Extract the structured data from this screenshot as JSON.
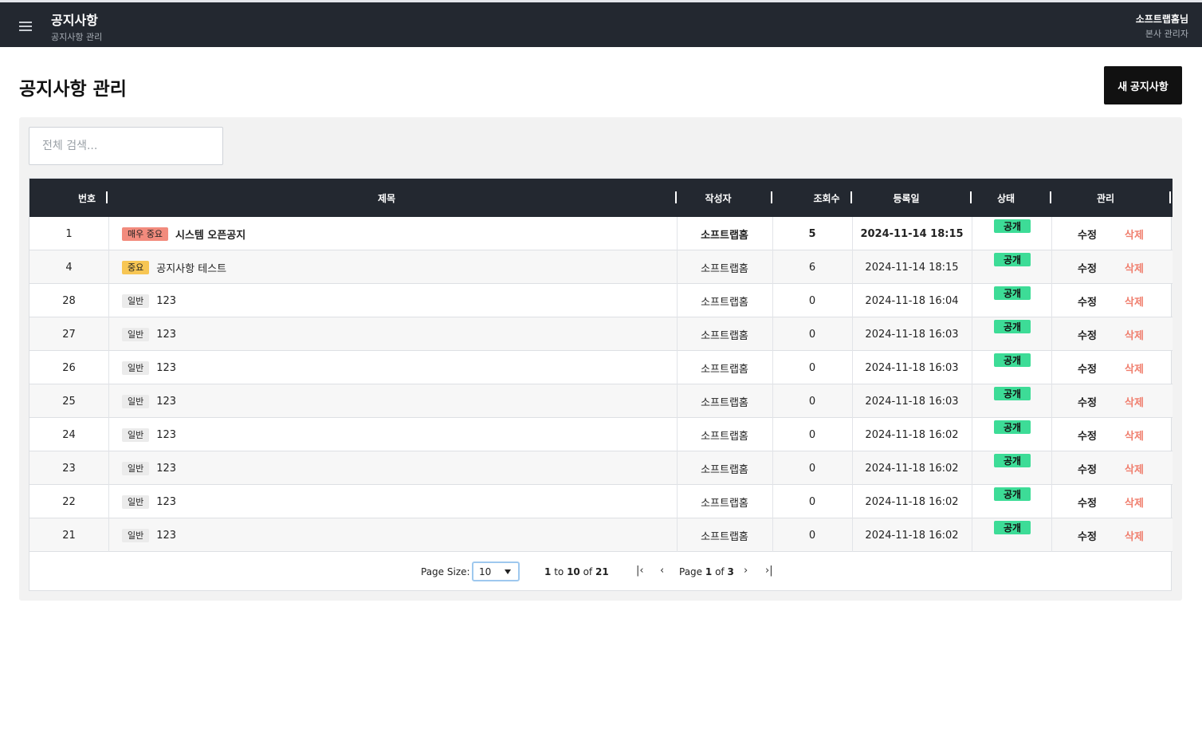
{
  "header": {
    "title": "공지사항",
    "subtitle": "공지사항 관리",
    "user_name": "소프트랩홈님",
    "user_role": "본사 관리자"
  },
  "page": {
    "title": "공지사항 관리",
    "new_button": "새 공지사항",
    "search_placeholder": "전체 검색..."
  },
  "table": {
    "columns": [
      "번호",
      "제목",
      "작성자",
      "조회수",
      "등록일",
      "상태",
      "관리"
    ],
    "edit_label": "수정",
    "delete_label": "삭제",
    "rows": [
      {
        "no": "1",
        "badge": "매우 중요",
        "badge_type": "urgent",
        "title": "시스템 오픈공지",
        "author": "소프트랩홈",
        "views": "5",
        "date": "2024-11-14 18:15",
        "status": "공개",
        "bold": true
      },
      {
        "no": "4",
        "badge": "중요",
        "badge_type": "important",
        "title": "공지사항 테스트",
        "author": "소프트랩홈",
        "views": "6",
        "date": "2024-11-14 18:15",
        "status": "공개",
        "bold": false
      },
      {
        "no": "28",
        "badge": "일반",
        "badge_type": "normal",
        "title": "123",
        "author": "소프트랩홈",
        "views": "0",
        "date": "2024-11-18 16:04",
        "status": "공개",
        "bold": false
      },
      {
        "no": "27",
        "badge": "일반",
        "badge_type": "normal",
        "title": "123",
        "author": "소프트랩홈",
        "views": "0",
        "date": "2024-11-18 16:03",
        "status": "공개",
        "bold": false
      },
      {
        "no": "26",
        "badge": "일반",
        "badge_type": "normal",
        "title": "123",
        "author": "소프트랩홈",
        "views": "0",
        "date": "2024-11-18 16:03",
        "status": "공개",
        "bold": false
      },
      {
        "no": "25",
        "badge": "일반",
        "badge_type": "normal",
        "title": "123",
        "author": "소프트랩홈",
        "views": "0",
        "date": "2024-11-18 16:03",
        "status": "공개",
        "bold": false
      },
      {
        "no": "24",
        "badge": "일반",
        "badge_type": "normal",
        "title": "123",
        "author": "소프트랩홈",
        "views": "0",
        "date": "2024-11-18 16:02",
        "status": "공개",
        "bold": false
      },
      {
        "no": "23",
        "badge": "일반",
        "badge_type": "normal",
        "title": "123",
        "author": "소프트랩홈",
        "views": "0",
        "date": "2024-11-18 16:02",
        "status": "공개",
        "bold": false
      },
      {
        "no": "22",
        "badge": "일반",
        "badge_type": "normal",
        "title": "123",
        "author": "소프트랩홈",
        "views": "0",
        "date": "2024-11-18 16:02",
        "status": "공개",
        "bold": false
      },
      {
        "no": "21",
        "badge": "일반",
        "badge_type": "normal",
        "title": "123",
        "author": "소프트랩홈",
        "views": "0",
        "date": "2024-11-18 16:02",
        "status": "공개",
        "bold": false
      }
    ]
  },
  "pagination": {
    "page_size_label": "Page Size:",
    "page_size": "10",
    "range_from": "1",
    "range_to_word": "to",
    "range_to": "10",
    "of_word": "of",
    "total": "21",
    "page_word": "Page",
    "current_page": "1",
    "total_pages": "3",
    "first_icon": "first-page-icon",
    "prev_icon": "prev-page-icon",
    "next_icon": "next-page-icon",
    "last_icon": "last-page-icon"
  },
  "colors": {
    "topbar": "#232830",
    "status_public": "#3ddc97",
    "badge_urgent": "#f28b7d",
    "badge_important": "#f7c654",
    "delete_text": "#f07f6e"
  }
}
